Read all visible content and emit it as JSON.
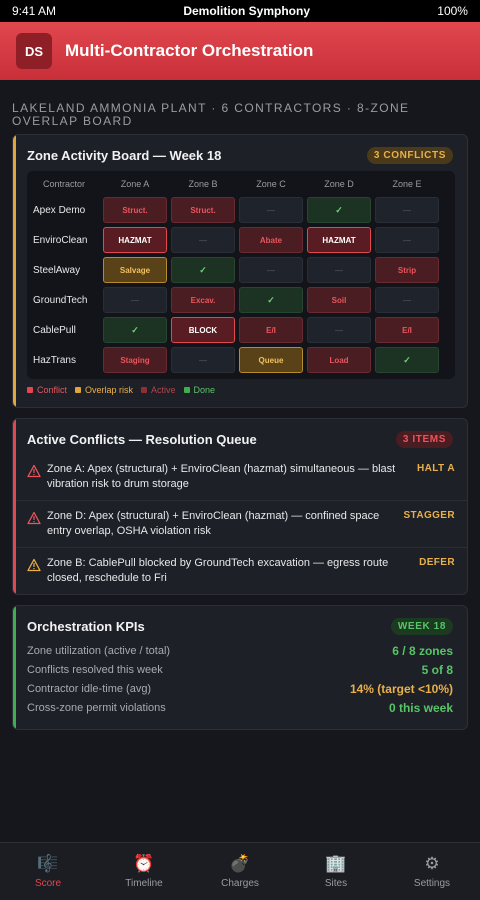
{
  "status": {
    "time": "9:41 AM",
    "carrier": "Demolition Symphony",
    "battery": "100%"
  },
  "app": {
    "badge": "DS",
    "title": "Multi-Contractor Orchestration"
  },
  "subhead": "Lakeland Ammonia Plant · 6 Contractors · 8-Zone Overlap Board",
  "board": {
    "title": "Zone Activity Board — Week 18",
    "badge": "3 CONFLICTS",
    "columns": [
      "Contractor",
      "Zone A",
      "Zone B",
      "Zone C",
      "Zone D",
      "Zone E"
    ],
    "rows": [
      {
        "name": "Apex Demo",
        "cells": [
          {
            "t": "Struct.",
            "s": "active"
          },
          {
            "t": "Struct.",
            "s": "active"
          },
          {
            "t": "—",
            "s": "empty"
          },
          {
            "t": "✓",
            "s": "done"
          },
          {
            "t": "—",
            "s": "empty"
          }
        ]
      },
      {
        "name": "EnviroClean",
        "cells": [
          {
            "t": "HAZMAT",
            "s": "conflict"
          },
          {
            "t": "—",
            "s": "empty"
          },
          {
            "t": "Abate",
            "s": "active"
          },
          {
            "t": "HAZMAT",
            "s": "conflict"
          },
          {
            "t": "—",
            "s": "empty"
          }
        ]
      },
      {
        "name": "SteelAway",
        "cells": [
          {
            "t": "Salvage",
            "s": "overlap"
          },
          {
            "t": "✓",
            "s": "done"
          },
          {
            "t": "—",
            "s": "empty"
          },
          {
            "t": "—",
            "s": "empty"
          },
          {
            "t": "Strip",
            "s": "active"
          }
        ]
      },
      {
        "name": "GroundTech",
        "cells": [
          {
            "t": "—",
            "s": "empty"
          },
          {
            "t": "Excav.",
            "s": "active"
          },
          {
            "t": "✓",
            "s": "done"
          },
          {
            "t": "Soil",
            "s": "active"
          },
          {
            "t": "—",
            "s": "empty"
          }
        ]
      },
      {
        "name": "CablePull",
        "cells": [
          {
            "t": "✓",
            "s": "done"
          },
          {
            "t": "BLOCK",
            "s": "conflict"
          },
          {
            "t": "E/I",
            "s": "active"
          },
          {
            "t": "—",
            "s": "empty"
          },
          {
            "t": "E/I",
            "s": "active"
          }
        ]
      },
      {
        "name": "HazTrans",
        "cells": [
          {
            "t": "Staging",
            "s": "active"
          },
          {
            "t": "—",
            "s": "empty"
          },
          {
            "t": "Queue",
            "s": "overlap"
          },
          {
            "t": "Load",
            "s": "active"
          },
          {
            "t": "✓",
            "s": "done"
          }
        ]
      }
    ],
    "legend": [
      {
        "label": "Conflict",
        "color": "#e0474f",
        "text_color": "#e9555c"
      },
      {
        "label": "Overlap risk",
        "color": "#e0a63a",
        "text_color": "#e9b04a"
      },
      {
        "label": "Active",
        "color": "#8e2f36",
        "text_color": "#b0454c"
      },
      {
        "label": "Done",
        "color": "#3fae4f",
        "text_color": "#57c566"
      }
    ]
  },
  "conflicts": {
    "title": "Active Conflicts — Resolution Queue",
    "badge": "3 ITEMS",
    "items": [
      {
        "text": "Zone A: Apex (structural) + EnviroClean (hazmat) simultaneous — blast vibration risk to drum storage",
        "action": "HALT A",
        "severity": "red"
      },
      {
        "text": "Zone D: Apex (structural) + EnviroClean (hazmat) — confined space entry overlap, OSHA violation risk",
        "action": "STAGGER",
        "severity": "red"
      },
      {
        "text": "Zone B: CablePull blocked by GroundTech excavation — egress route closed, reschedule to Fri",
        "action": "DEFER",
        "severity": "amber"
      }
    ]
  },
  "kpis": {
    "title": "Orchestration KPIs",
    "badge": "WEEK 18",
    "rows": [
      {
        "label": "Zone utilization (active / total)",
        "value": "6 / 8 zones",
        "color": "#57c566"
      },
      {
        "label": "Conflicts resolved this week",
        "value": "5 of 8",
        "color": "#57c566"
      },
      {
        "label": "Contractor idle-time (avg)",
        "value": "14% (target <10%)",
        "color": "#e9b04a"
      },
      {
        "label": "Cross-zone permit violations",
        "value": "0 this week",
        "color": "#57c566"
      }
    ]
  },
  "tabs": [
    {
      "label": "Score",
      "icon": "🎼",
      "icon_name": "score-icon",
      "active": true
    },
    {
      "label": "Timeline",
      "icon": "⏰",
      "icon_name": "alarm-clock-icon",
      "active": false
    },
    {
      "label": "Charges",
      "icon": "💣",
      "icon_name": "bomb-icon",
      "active": false
    },
    {
      "label": "Sites",
      "icon": "🏢",
      "icon_name": "building-icon",
      "active": false
    },
    {
      "label": "Settings",
      "icon": "⚙",
      "icon_name": "gear-icon",
      "active": false
    }
  ]
}
